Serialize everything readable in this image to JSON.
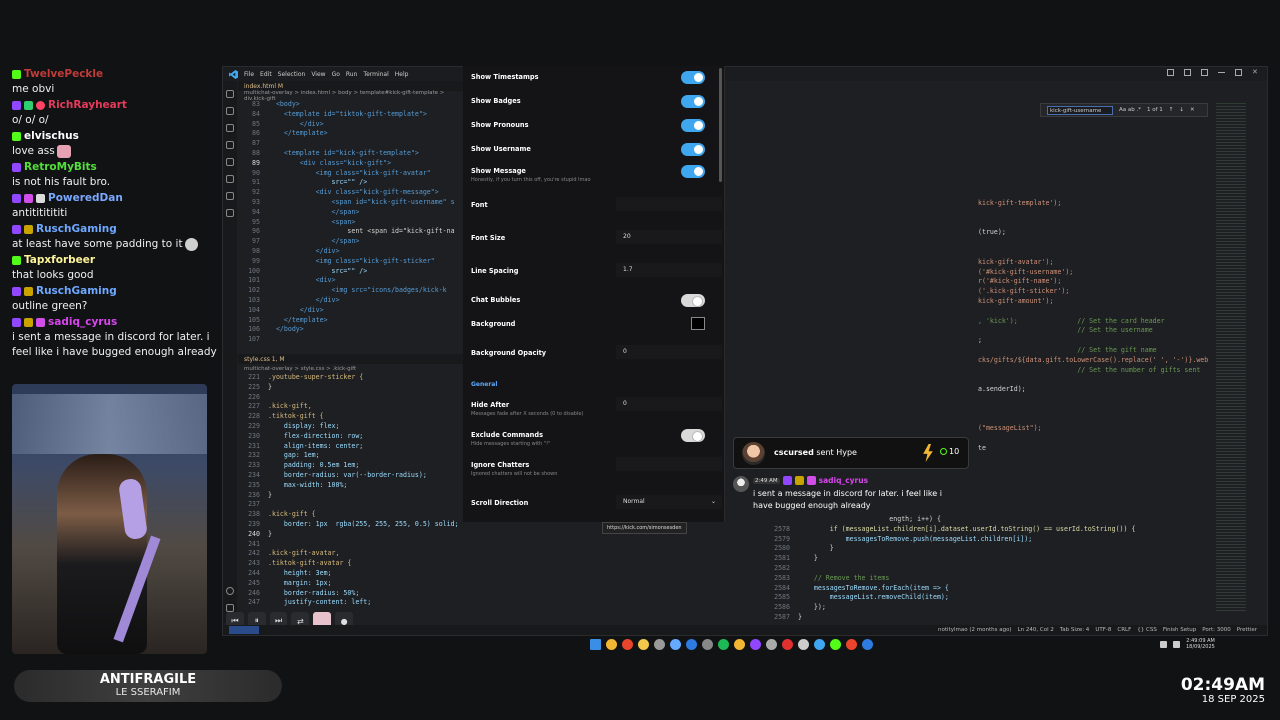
{
  "chat": [
    {
      "user": "TwelvePeckle",
      "color": "#c23b3b",
      "badges": [
        "b-kick"
      ],
      "message": "me obvi"
    },
    {
      "user": "RichRayheart",
      "color": "#e53b5b",
      "badges": [
        "b-twitch",
        "b-shield",
        "b-heart"
      ],
      "message": "o/ o/ o/"
    },
    {
      "user": "elvischus",
      "color": "#ffffff",
      "badges": [
        "b-kick"
      ],
      "message": "love ass",
      "emote": true
    },
    {
      "user": "RetroMyBits",
      "color": "#53e03b",
      "badges": [
        "b-twitch"
      ],
      "message": "is not his fault bro."
    },
    {
      "user": "PoweredDan",
      "color": "#7aa8ff",
      "badges": [
        "b-twitch",
        "b-gem",
        "b-shield2"
      ],
      "message": "antitititititi"
    },
    {
      "user": "RuschGaming",
      "color": "#6ea8ff",
      "badges": [
        "b-twitch",
        "b-sub"
      ],
      "message": "at least have some padding to it",
      "emote2": true
    },
    {
      "user": "Tapxforbeer",
      "color": "#fff59a",
      "badges": [
        "b-kick"
      ],
      "message": "that looks good"
    },
    {
      "user": "RuschGaming",
      "color": "#6ea8ff",
      "badges": [
        "b-twitch",
        "b-sub"
      ],
      "message": "outline green?"
    },
    {
      "user": "sadiq_cyrus",
      "color": "#d946ef",
      "badges": [
        "b-twitch",
        "b-sub",
        "b-gem"
      ],
      "message": "i sent a message in discord for later. i feel like i have bugged enough already"
    }
  ],
  "music": {
    "title": "ANTIFRAGILE",
    "artist": "LE SSERAFIM"
  },
  "clock": {
    "time": "02:49AM",
    "date": "18 SEP 2025"
  },
  "vscode": {
    "menu": [
      "File",
      "Edit",
      "Selection",
      "View",
      "Go",
      "Run",
      "Terminal",
      "Help"
    ],
    "tab_top": "index.html M",
    "crumbs_top": "multichat-overlay  >  index.html  >  body  >  template#kick-gift-template  >  div.kick-gift",
    "tab_bottom": "style.css 1, M",
    "crumbs_bottom": "multichat-overlay  >  style.css  >  .kick-gift",
    "find": {
      "value": "kick-gift-username",
      "count": "1 of 1",
      "options": "Aa  ab  .*"
    },
    "status": [
      "notitylmao (2 months ago)",
      "Ln 240, Col 2",
      "Tab Size: 4",
      "UTF-8",
      "CRLF",
      "{} CSS",
      "Finish Setup",
      "Port: 3000",
      "Prettier"
    ],
    "top_code": [
      {
        "n": "83",
        "t": "  <body>",
        "cls": "tok-tag"
      },
      {
        "n": "84",
        "t": "    <template id=\"tiktok-gift-template\">",
        "cls": "tok-tag"
      },
      {
        "n": "85",
        "t": "        </div>",
        "cls": "tok-tag"
      },
      {
        "n": "86",
        "t": "    </template>",
        "cls": "tok-tag"
      },
      {
        "n": "87",
        "t": "",
        "cls": "tok-txt"
      },
      {
        "n": "88",
        "t": "    <template id=\"kick-gift-template\">",
        "cls": "tok-tag"
      },
      {
        "n": "89",
        "t": "        <div class=\"kick-gift\">",
        "cls": "tok-tag",
        "cur": true
      },
      {
        "n": "90",
        "t": "            <img class=\"kick-gift-avatar\"",
        "cls": "tok-tag"
      },
      {
        "n": "91",
        "t": "                src=\"\" />",
        "cls": "tok-attr"
      },
      {
        "n": "92",
        "t": "            <div class=\"kick-gift-message\">",
        "cls": "tok-tag"
      },
      {
        "n": "93",
        "t": "                <span id=\"kick-gift-username\" s",
        "cls": "tok-tag"
      },
      {
        "n": "94",
        "t": "                </span>",
        "cls": "tok-tag"
      },
      {
        "n": "95",
        "t": "                <span>",
        "cls": "tok-tag"
      },
      {
        "n": "96",
        "t": "                    sent <span id=\"kick-gift-na",
        "cls": "tok-txt"
      },
      {
        "n": "97",
        "t": "                </span>",
        "cls": "tok-tag"
      },
      {
        "n": "98",
        "t": "            </div>",
        "cls": "tok-tag"
      },
      {
        "n": "99",
        "t": "            <img class=\"kick-gift-sticker\"",
        "cls": "tok-tag"
      },
      {
        "n": "100",
        "t": "                src=\"\" />",
        "cls": "tok-attr"
      },
      {
        "n": "101",
        "t": "            <div>",
        "cls": "tok-tag"
      },
      {
        "n": "102",
        "t": "                <img src=\"icons/badges/kick-k",
        "cls": "tok-tag"
      },
      {
        "n": "103",
        "t": "            </div>",
        "cls": "tok-tag"
      },
      {
        "n": "104",
        "t": "        </div>",
        "cls": "tok-tag"
      },
      {
        "n": "105",
        "t": "    </template>",
        "cls": "tok-tag"
      },
      {
        "n": "106",
        "t": "  </body>",
        "cls": "tok-tag"
      },
      {
        "n": "107",
        "t": "",
        "cls": "tok-txt"
      }
    ],
    "bottom_code": [
      {
        "n": "221",
        "t": ".youtube-super-sticker {",
        "cls": "tok-sel"
      },
      {
        "n": "225",
        "t": "}",
        "cls": "tok-txt"
      },
      {
        "n": "226",
        "t": "",
        "cls": "tok-txt"
      },
      {
        "n": "227",
        "t": ".kick-gift,",
        "cls": "tok-sel"
      },
      {
        "n": "228",
        "t": ".tiktok-gift {",
        "cls": "tok-sel"
      },
      {
        "n": "229",
        "t": "    display: flex;",
        "cls": "tok-prop"
      },
      {
        "n": "230",
        "t": "    flex-direction: row;",
        "cls": "tok-prop"
      },
      {
        "n": "231",
        "t": "    align-items: center;",
        "cls": "tok-prop"
      },
      {
        "n": "232",
        "t": "    gap: 1em;",
        "cls": "tok-prop"
      },
      {
        "n": "233",
        "t": "    padding: 0.5em 1em;",
        "cls": "tok-prop"
      },
      {
        "n": "234",
        "t": "    border-radius: var(--border-radius);",
        "cls": "tok-prop"
      },
      {
        "n": "235",
        "t": "    max-width: 100%;",
        "cls": "tok-prop"
      },
      {
        "n": "236",
        "t": "}",
        "cls": "tok-txt"
      },
      {
        "n": "237",
        "t": "",
        "cls": "tok-txt"
      },
      {
        "n": "238",
        "t": ".kick-gift {",
        "cls": "tok-sel"
      },
      {
        "n": "239",
        "t": "    border: 1px  rgba(255, 255, 255, 0.5) solid;",
        "cls": "tok-prop"
      },
      {
        "n": "240",
        "t": "}",
        "cls": "tok-txt",
        "cur": true
      },
      {
        "n": "241",
        "t": "",
        "cls": "tok-txt"
      },
      {
        "n": "242",
        "t": ".kick-gift-avatar,",
        "cls": "tok-sel"
      },
      {
        "n": "243",
        "t": ".tiktok-gift-avatar {",
        "cls": "tok-sel"
      },
      {
        "n": "244",
        "t": "    height: 3em;",
        "cls": "tok-prop"
      },
      {
        "n": "245",
        "t": "    margin: 1px;",
        "cls": "tok-prop"
      },
      {
        "n": "246",
        "t": "    border-radius: 50%;",
        "cls": "tok-prop"
      },
      {
        "n": "247",
        "t": "    justify-content: left;",
        "cls": "tok-prop"
      }
    ],
    "right_code": [
      {
        "t": "kick-gift-template');",
        "cls": "tok-str"
      },
      {
        "t": "",
        "cls": "tok-txt"
      },
      {
        "t": "",
        "cls": "tok-txt"
      },
      {
        "t": "(true);",
        "cls": "tok-txt"
      },
      {
        "t": "",
        "cls": "tok-txt"
      },
      {
        "t": "",
        "cls": "tok-txt"
      },
      {
        "t": "kick-gift-avatar');",
        "cls": "tok-str"
      },
      {
        "t": "('#kick-gift-username');",
        "cls": "tok-str"
      },
      {
        "t": "r('#kick-gift-name');",
        "cls": "tok-str"
      },
      {
        "t": "('.kick-gift-sticker');",
        "cls": "tok-str"
      },
      {
        "t": "kick-gift-amount');",
        "cls": "tok-str"
      },
      {
        "t": "",
        "cls": "tok-txt"
      },
      {
        "t": ", 'kick');               // Set the card header",
        "cls": "tok-com"
      },
      {
        "t": "                         // Set the username",
        "cls": "tok-com"
      },
      {
        "t": ";",
        "cls": "tok-txt"
      },
      {
        "t": "                         // Set the gift name",
        "cls": "tok-com"
      },
      {
        "t": "cks/gifts/${data.gift.toLowerCase().replace(' ', '-')}.web",
        "cls": "tok-str"
      },
      {
        "t": "                         // Set the number of gifts sent",
        "cls": "tok-com"
      },
      {
        "t": "",
        "cls": "tok-txt"
      },
      {
        "t": "a.senderId);",
        "cls": "tok-txt"
      },
      {
        "t": "",
        "cls": "tok-txt"
      },
      {
        "t": "",
        "cls": "tok-txt"
      },
      {
        "t": "",
        "cls": "tok-txt"
      },
      {
        "t": "(\"messageList\");",
        "cls": "tok-str"
      },
      {
        "t": "",
        "cls": "tok-txt"
      },
      {
        "t": "te",
        "cls": "tok-txt"
      }
    ],
    "bot_right_code": [
      {
        "n": "",
        "t": "                       ength; i++) {",
        "cls": "tok-txt"
      },
      {
        "n": "2578",
        "t": "        if (messageList.children[i].dataset.userId.toString() == userId.toString()) {",
        "cls": "tok-fn"
      },
      {
        "n": "2579",
        "t": "            messagesToRemove.push(messageList.children[i]);",
        "cls": "tok-prop"
      },
      {
        "n": "2580",
        "t": "        }",
        "cls": "tok-txt"
      },
      {
        "n": "2581",
        "t": "    }",
        "cls": "tok-txt"
      },
      {
        "n": "2582",
        "t": "",
        "cls": "tok-txt"
      },
      {
        "n": "2583",
        "t": "    // Remove the items",
        "cls": "tok-com"
      },
      {
        "n": "2584",
        "t": "    messagesToRemove.forEach(item => {",
        "cls": "tok-prop"
      },
      {
        "n": "2585",
        "t": "        messageList.removeChild(item);",
        "cls": "tok-prop"
      },
      {
        "n": "2586",
        "t": "    });",
        "cls": "tok-txt"
      },
      {
        "n": "2587",
        "t": "}",
        "cls": "tok-txt"
      }
    ]
  },
  "settings": {
    "rows": [
      {
        "label": "Show Timestamps",
        "type": "toggle",
        "on": true
      },
      {
        "label": "Show Badges",
        "type": "toggle",
        "on": true
      },
      {
        "label": "Show Pronouns",
        "type": "toggle",
        "on": true
      },
      {
        "label": "Show Username",
        "type": "toggle",
        "on": true
      },
      {
        "label": "Show Message",
        "sub": "Honestly, if you turn this off, you're stupid lmao",
        "type": "toggle",
        "on": true
      },
      {
        "label": "Font",
        "type": "input",
        "value": ""
      },
      {
        "label": "Font Size",
        "type": "input",
        "value": "20"
      },
      {
        "label": "Line Spacing",
        "type": "input",
        "value": "1.7"
      },
      {
        "label": "Chat Bubbles",
        "type": "toggle",
        "on": false
      },
      {
        "label": "Background",
        "type": "color",
        "value": "#000000"
      },
      {
        "label": "Background Opacity",
        "type": "input",
        "value": "0"
      },
      {
        "label": "General",
        "type": "section"
      },
      {
        "label": "Hide After",
        "sub": "Messages fade after X seconds (0 to disable)",
        "type": "input",
        "value": "0"
      },
      {
        "label": "Exclude Commands",
        "sub": "Hide messages starting with \"!\"",
        "type": "toggle",
        "on": false
      },
      {
        "label": "Ignore Chatters",
        "sub": "Ignored chatters will not be shown",
        "type": "input",
        "value": ""
      },
      {
        "label": "Scroll Direction",
        "type": "select",
        "value": "Normal"
      }
    ],
    "tooltip": "https://kick.com/simonsesden"
  },
  "gift_card": {
    "user": "cscursed",
    "text": "sent Hype",
    "amount": "10"
  },
  "msg_card": {
    "time": "2:49 AM",
    "user": "sadiq_cyrus",
    "message": "i sent a message in discord for later. i feel like i have bugged enough already"
  },
  "taskbar_colors": [
    "#3a8ee6",
    "#f2b632",
    "#e8452c",
    "#f2c94c",
    "#999999",
    "#66aaff",
    "#2d7be0",
    "#888888",
    "#1db954",
    "#f2b632",
    "#9146ff",
    "#aaaaaa",
    "#e03131",
    "#cccccc",
    "#3fa6f0",
    "#53fc18",
    "#e8452c",
    "#2d7be0"
  ],
  "tray": {
    "time": "2:49:09 AM",
    "date": "18/09/2025"
  }
}
